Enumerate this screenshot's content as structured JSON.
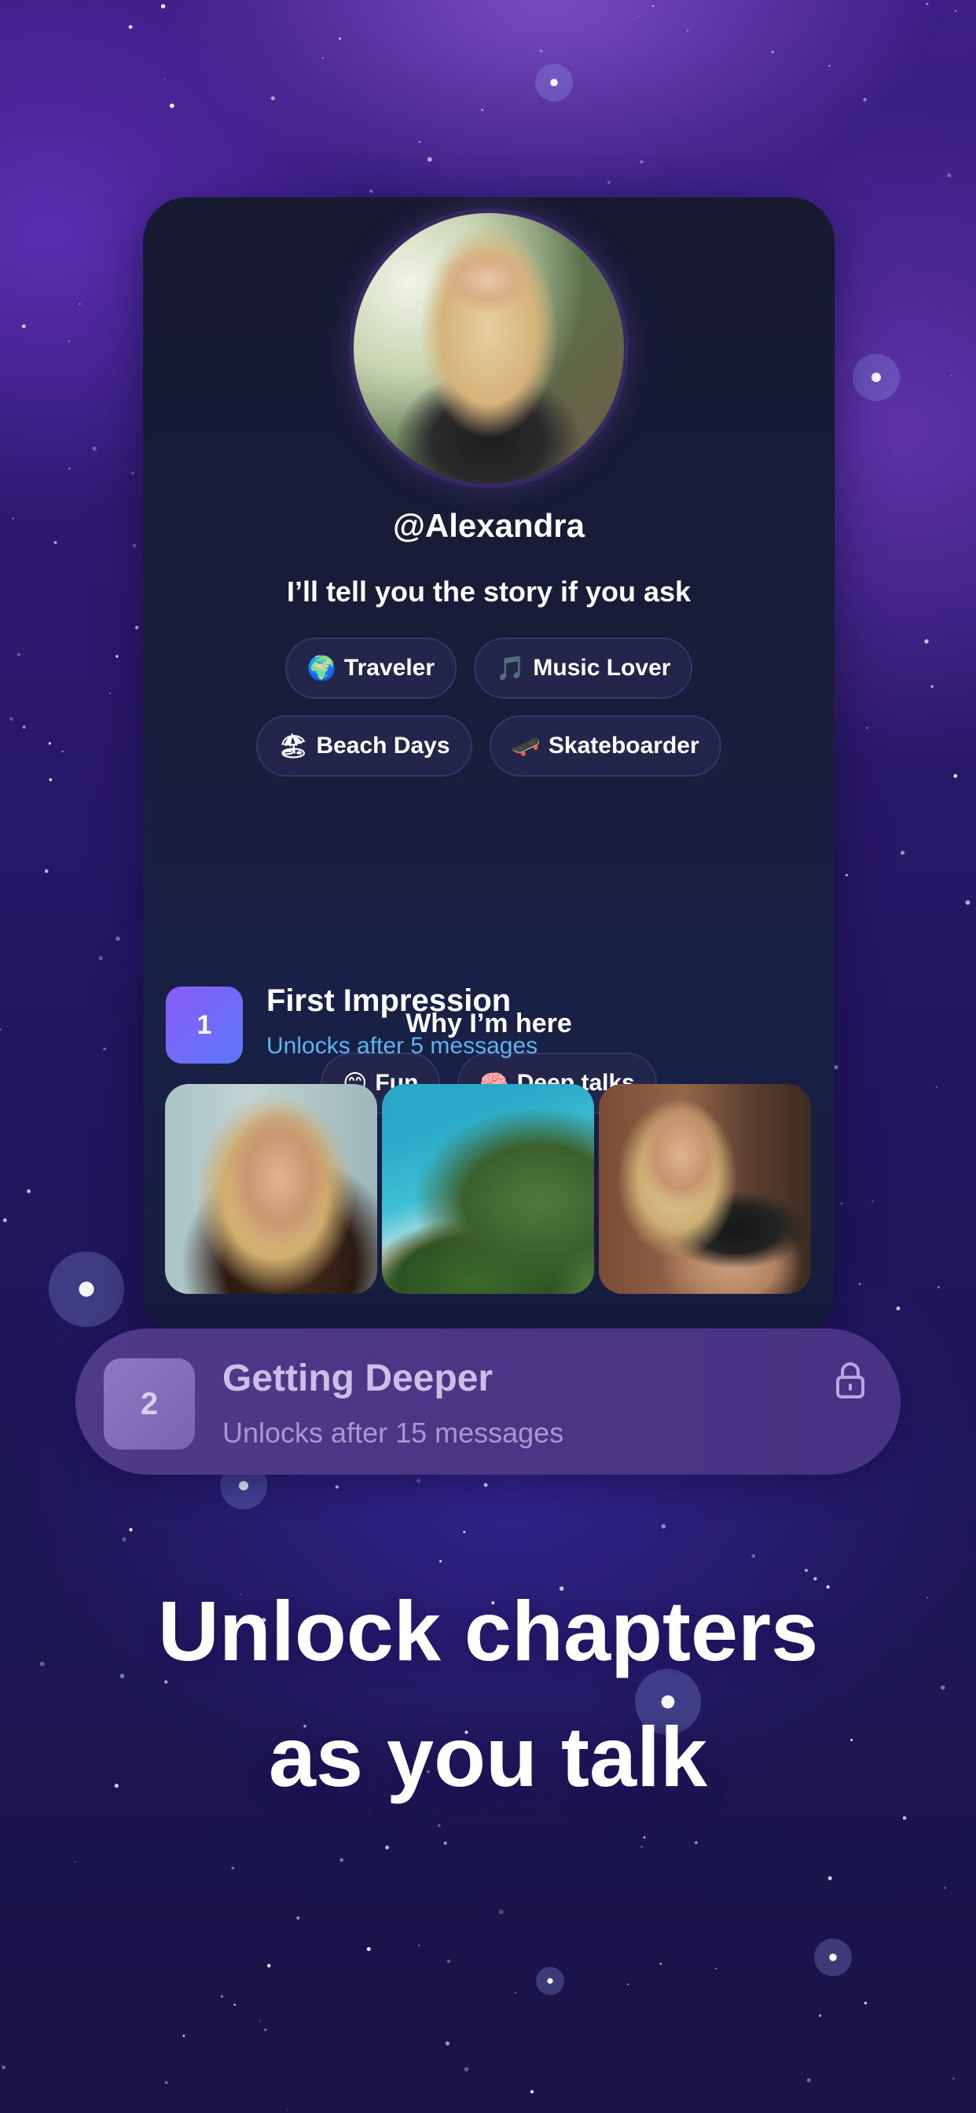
{
  "profile": {
    "username": "@Alexandra",
    "tagline": "I’ll tell you the story if you ask",
    "interests": [
      {
        "emoji": "🌍",
        "label": "Traveler"
      },
      {
        "emoji": "🎵",
        "label": "Music Lover"
      },
      {
        "emoji": "🏖",
        "label": "Beach Days"
      },
      {
        "emoji": "🛹",
        "label": "Skateboarder"
      }
    ],
    "why_title": "Why I’m here",
    "reasons": [
      {
        "emoji": "😊",
        "label": "Fun"
      },
      {
        "emoji": "🧠",
        "label": "Deep talks"
      }
    ]
  },
  "chapters": [
    {
      "number": "1",
      "title": "First Impression",
      "subtitle": "Unlocks after 5 messages",
      "locked": false
    },
    {
      "number": "2",
      "title": "Getting Deeper",
      "subtitle": "Unlocks after 15 messages",
      "locked": true
    }
  ],
  "headline": {
    "line1": "Unlock chapters",
    "line2": "as you talk"
  },
  "colors": {
    "background": "#2a1a6e",
    "card": "#191d3a",
    "chip": "#23264a",
    "accent_blue": "#5db4ee",
    "badge_gradient_start": "#8a5cf7",
    "badge_gradient_end": "#5b77f9",
    "locked_chapter": "#4b3584"
  },
  "icons": {
    "lock": "lock-icon"
  }
}
